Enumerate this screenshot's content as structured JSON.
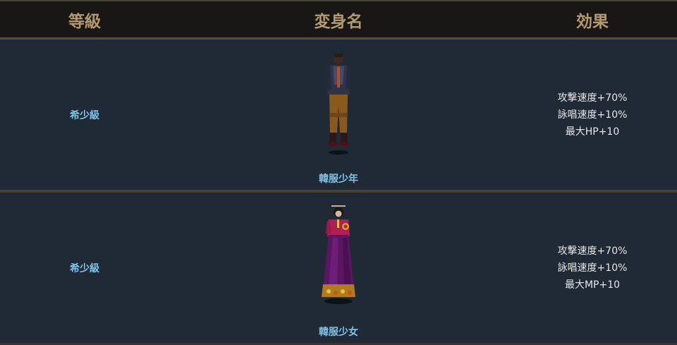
{
  "header": {
    "col_grade": "等級",
    "col_name": "変身名",
    "col_effect": "効果"
  },
  "rows": [
    {
      "grade": "希少級",
      "name": "韓服少年",
      "effects": [
        "攻撃速度+70%",
        "詠唱速度+10%",
        "最大HP+10"
      ]
    },
    {
      "grade": "希少級",
      "name": "韓服少女",
      "effects": [
        "攻撃速度+70%",
        "詠唱速度+10%",
        "最大MP+10"
      ]
    }
  ],
  "colors": {
    "header_text": "#b39a6e",
    "accent_text": "#7fc3e8",
    "body_bg": "#1f2a36"
  }
}
